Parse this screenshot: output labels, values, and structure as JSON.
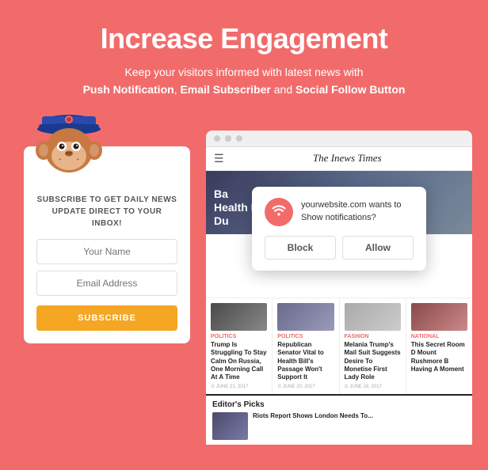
{
  "header": {
    "title": "Increase Engagement",
    "subtitle_plain": "Keep your visitors informed with latest news with",
    "subtitle_bold1": "Push Notification",
    "subtitle_sep1": ", ",
    "subtitle_bold2": "Email Subscriber",
    "subtitle_sep2": " and ",
    "subtitle_bold3": "Social Follow Button"
  },
  "left_card": {
    "subscribe_title": "SUBSCRIBE TO GET DAILY NEWS UPDATE DIRECT TO YOUR INBOX!",
    "name_placeholder": "Your Name",
    "email_placeholder": "Email Address",
    "button_label": "SUBSCRIBE"
  },
  "browser": {
    "title": "The Inews Times",
    "hero_text": "Ba\nHealth Bill's\nDu"
  },
  "notification": {
    "domain": "yourwebsite.com",
    "message": "yourwebsite.com wants to Show notifications?",
    "block_label": "Block",
    "allow_label": "Allow"
  },
  "news_columns": [
    {
      "tag": "POLITICS",
      "title": "Trump Is Struggling To Stay Calm On Russia, One Morning Call At A Time",
      "date": "JUNE 21, 2017"
    },
    {
      "tag": "POLITICS",
      "title": "Republican Senator Vital to Health Bill's Passage Won't Support It",
      "date": "JUNE 20, 2017"
    },
    {
      "tag": "FASHION",
      "title": "Melania Trump's Mail Suit Suggests Desire To Monetise First Lady Role",
      "date": "JUNE 19, 2017"
    },
    {
      "tag": "NATIONAL",
      "title": "This Secret Room D Mount Rushmore B Having A Moment",
      "date": ""
    }
  ],
  "editors": {
    "section_title": "Editor's Picks",
    "item_title": "Riots Report Shows London Needs To..."
  }
}
